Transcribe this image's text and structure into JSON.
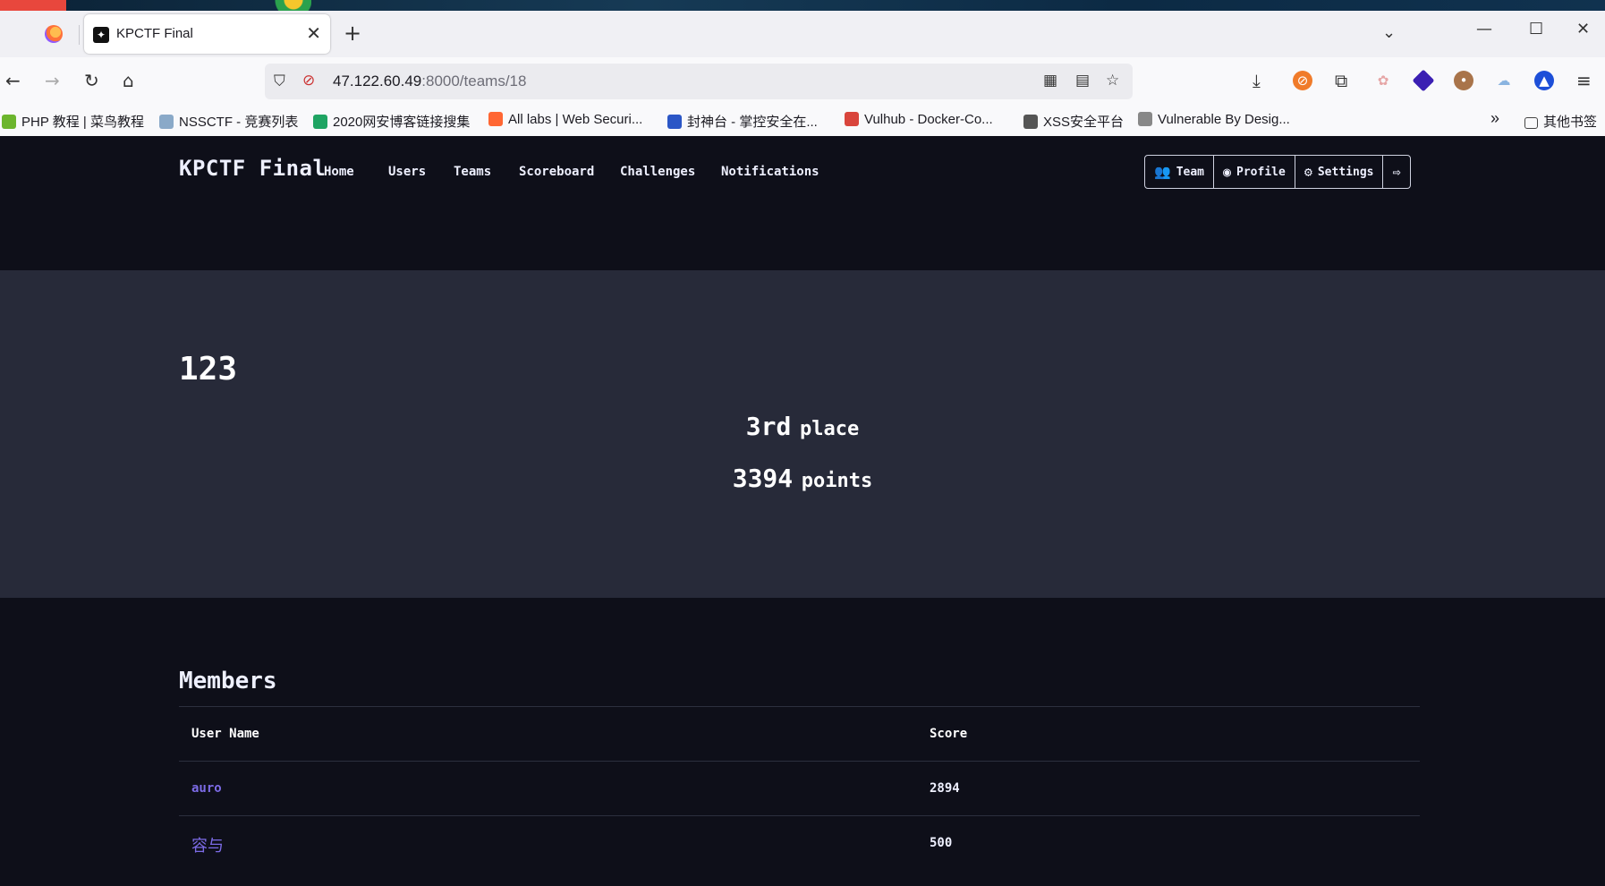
{
  "browser": {
    "tab_title": "KPCTF Final",
    "tab_close": "✕",
    "new_tab": "+",
    "url_host": "47.122.60.49",
    "url_rest": ":8000/teams/18",
    "bookmarks": [
      {
        "label": "PHP 教程 | 菜鸟教程",
        "color": "#6cb52d"
      },
      {
        "label": "NSSCTF - 竞赛列表",
        "color": "#8aa9c8"
      },
      {
        "label": "2020网安博客链接搜集",
        "color": "#1fa463"
      },
      {
        "label": "All labs | Web Securi...",
        "color": "#ff6633"
      },
      {
        "label": "封神台 - 掌控安全在...",
        "color": "#2b56c6"
      },
      {
        "label": "Vulhub - Docker-Co...",
        "color": "#d9453c"
      },
      {
        "label": "XSS安全平台",
        "color": "#555555"
      },
      {
        "label": "Vulnerable By Desig...",
        "color": "#888888"
      }
    ],
    "other_bookmarks": "其他书签"
  },
  "site": {
    "brand": "KPCTF Final",
    "nav": [
      "Home",
      "Users",
      "Teams",
      "Scoreboard",
      "Challenges",
      "Notifications"
    ],
    "user_buttons": {
      "team": "Team",
      "profile": "Profile",
      "settings": "Settings"
    },
    "team": {
      "name": "123",
      "place_value": "3rd",
      "place_label": "place",
      "points_value": "3394",
      "points_label": "points"
    },
    "members": {
      "title": "Members",
      "columns": [
        "User Name",
        "Score"
      ],
      "rows": [
        {
          "name": "auro",
          "score": "2894"
        },
        {
          "name": "容与",
          "score": "500"
        }
      ]
    }
  }
}
